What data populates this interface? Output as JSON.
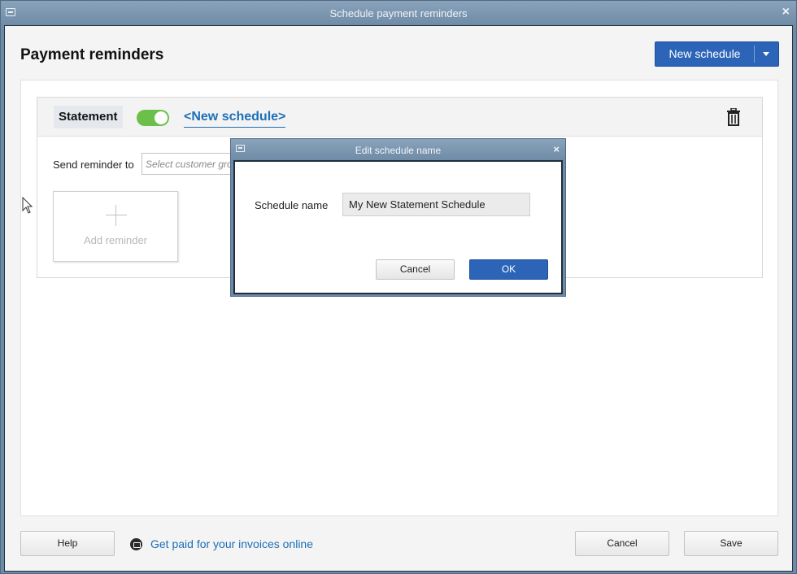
{
  "window": {
    "title": "Schedule payment reminders"
  },
  "header": {
    "page_title": "Payment reminders",
    "new_schedule_label": "New schedule"
  },
  "schedule_card": {
    "type_label": "Statement",
    "toggle_on": true,
    "schedule_name_link": "<New schedule>",
    "send_reminder_label": "Send reminder to",
    "customer_group_placeholder": "Select customer group",
    "add_reminder_label": "Add reminder"
  },
  "footer": {
    "help_label": "Help",
    "get_paid_link": "Get paid for your invoices online",
    "cancel_label": "Cancel",
    "save_label": "Save"
  },
  "dialog": {
    "title": "Edit schedule name",
    "field_label": "Schedule name",
    "field_value": "My New Statement Schedule",
    "cancel_label": "Cancel",
    "ok_label": "OK"
  },
  "colors": {
    "accent_blue": "#2c64b8",
    "link_blue": "#1c6fb7",
    "toggle_green": "#6cc04a",
    "titlebar": "#7a96b0"
  }
}
